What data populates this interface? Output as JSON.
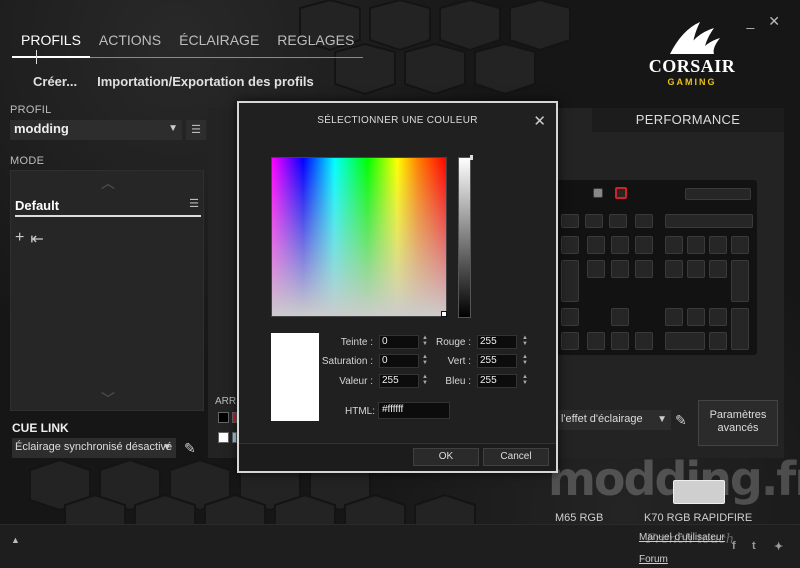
{
  "window": {
    "minimize": "_",
    "close": "✕"
  },
  "nav": {
    "tabs": [
      "PROFILS",
      "ACTIONS",
      "ÉCLAIRAGE",
      "REGLAGES"
    ],
    "active_index": 0
  },
  "subnav": {
    "create": "Créer...",
    "import_export": "Importation/Exportation des profils"
  },
  "logo": {
    "brand": "CORSAIR",
    "sub": "GAMING"
  },
  "profile": {
    "label": "PROFIL",
    "value": "modding"
  },
  "mode": {
    "label": "MODE",
    "item": "Default"
  },
  "cue_link": {
    "label": "CUE LINK",
    "value": "Éclairage synchronisé désactivé"
  },
  "right": {
    "performance_tab": "PERFORMANCE",
    "arr_label": "ARRI",
    "effect_select": "l'effet d'éclairage",
    "advanced_button": "Paramètres avancés"
  },
  "colors": {
    "accent": "#ffffff",
    "dialog_border": "#d6d6d6",
    "selected_color": "#ffffff"
  },
  "dialog": {
    "title": "SÉLECTIONNER UNE COULEUR",
    "fields": {
      "teinte": {
        "label": "Teinte :",
        "value": "0"
      },
      "saturation": {
        "label": "Saturation :",
        "value": "0"
      },
      "valeur": {
        "label": "Valeur :",
        "value": "255"
      },
      "rouge": {
        "label": "Rouge :",
        "value": "255"
      },
      "vert": {
        "label": "Vert :",
        "value": "255"
      },
      "bleu": {
        "label": "Bleu :",
        "value": "255"
      },
      "html": {
        "label": "HTML:",
        "value": "#ffffff"
      }
    },
    "ok": "OK",
    "cancel": "Cancel"
  },
  "footer": {
    "device_m65": "M65 RGB",
    "device_k70": "K70 RGB RAPIDFIRE",
    "manual": "Manuel d'utilisateur",
    "forum": "Forum",
    "social": [
      "f",
      "t",
      "✦"
    ]
  },
  "watermark": {
    "main": "modding.fr",
    "sub": "French touch"
  }
}
